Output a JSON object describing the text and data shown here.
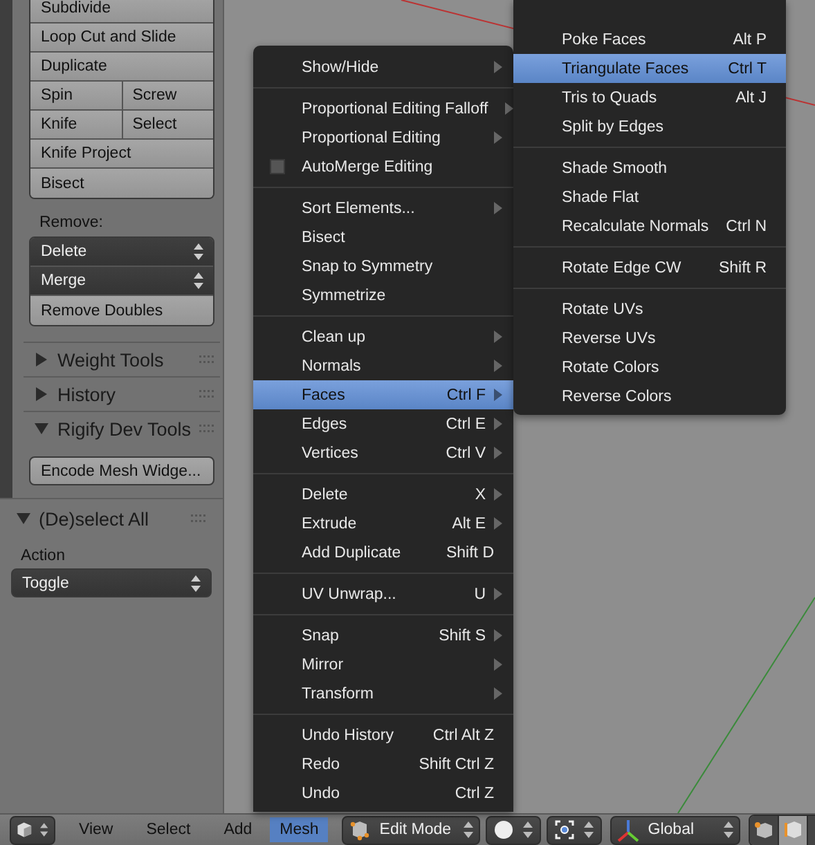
{
  "tool_shelf": {
    "button_rows": [
      [
        "Subdivide"
      ],
      [
        "Loop Cut and Slide"
      ],
      [
        "Duplicate"
      ],
      [
        "Spin",
        "Screw"
      ],
      [
        "Knife",
        "Select"
      ],
      [
        "Knife Project"
      ],
      [
        "Bisect"
      ]
    ],
    "remove_label": "Remove:",
    "remove_controls": [
      {
        "kind": "dropdown",
        "label": "Delete"
      },
      {
        "kind": "dropdown",
        "label": "Merge"
      },
      {
        "kind": "button",
        "label": "Remove Doubles"
      }
    ],
    "panels": [
      {
        "title": "Weight Tools",
        "expanded": false
      },
      {
        "title": "History",
        "expanded": false
      },
      {
        "title": "Rigify Dev Tools",
        "expanded": true
      }
    ],
    "rigify_button": "Encode Mesh Widge..."
  },
  "operator_panel": {
    "title": "(De)select All",
    "expanded": true,
    "field_label": "Action",
    "field_value": "Toggle"
  },
  "mesh_menu": {
    "sections": [
      [
        {
          "label": "Show/Hide",
          "submenu": true,
          "selected": false,
          "kind": "item"
        }
      ],
      [
        {
          "label": "Proportional Editing Falloff",
          "submenu": true,
          "selected": false,
          "kind": "item"
        },
        {
          "label": "Proportional Editing",
          "submenu": true,
          "selected": false,
          "kind": "item"
        },
        {
          "label": "AutoMerge Editing",
          "submenu": false,
          "selected": false,
          "kind": "checkbox",
          "checked": false
        }
      ],
      [
        {
          "label": "Sort Elements...",
          "submenu": true,
          "selected": false,
          "kind": "item"
        },
        {
          "label": "Bisect",
          "submenu": false,
          "selected": false,
          "kind": "item"
        },
        {
          "label": "Snap to Symmetry",
          "submenu": false,
          "selected": false,
          "kind": "item"
        },
        {
          "label": "Symmetrize",
          "submenu": false,
          "selected": false,
          "kind": "item"
        }
      ],
      [
        {
          "label": "Clean up",
          "submenu": true,
          "selected": false,
          "kind": "item"
        },
        {
          "label": "Normals",
          "submenu": true,
          "selected": false,
          "kind": "item"
        },
        {
          "label": "Faces",
          "shortcut": "Ctrl F",
          "submenu": true,
          "selected": true,
          "kind": "item"
        },
        {
          "label": "Edges",
          "shortcut": "Ctrl E",
          "submenu": true,
          "selected": false,
          "kind": "item"
        },
        {
          "label": "Vertices",
          "shortcut": "Ctrl V",
          "submenu": true,
          "selected": false,
          "kind": "item"
        }
      ],
      [
        {
          "label": "Delete",
          "shortcut": "X",
          "submenu": true,
          "selected": false,
          "kind": "item"
        },
        {
          "label": "Extrude",
          "shortcut": "Alt E",
          "submenu": true,
          "selected": false,
          "kind": "item"
        },
        {
          "label": "Add Duplicate",
          "shortcut": "Shift D",
          "submenu": false,
          "selected": false,
          "kind": "item"
        }
      ],
      [
        {
          "label": "UV Unwrap...",
          "shortcut": "U",
          "submenu": true,
          "selected": false,
          "kind": "item"
        }
      ],
      [
        {
          "label": "Snap",
          "shortcut": "Shift S",
          "submenu": true,
          "selected": false,
          "kind": "item"
        },
        {
          "label": "Mirror",
          "submenu": true,
          "selected": false,
          "kind": "item"
        },
        {
          "label": "Transform",
          "submenu": true,
          "selected": false,
          "kind": "item"
        }
      ],
      [
        {
          "label": "Undo History",
          "shortcut": "Ctrl Alt Z",
          "submenu": false,
          "selected": false,
          "kind": "item"
        },
        {
          "label": "Redo",
          "shortcut": "Shift Ctrl Z",
          "submenu": false,
          "selected": false,
          "kind": "item"
        },
        {
          "label": "Undo",
          "shortcut": "Ctrl Z",
          "submenu": false,
          "selected": false,
          "kind": "item"
        }
      ]
    ]
  },
  "faces_submenu": {
    "sections": [
      [
        {
          "label": "Poke Faces",
          "shortcut": "Alt P",
          "submenu": false,
          "selected": false,
          "kind": "item"
        },
        {
          "label": "Triangulate Faces",
          "shortcut": "Ctrl T",
          "submenu": false,
          "selected": true,
          "kind": "item"
        },
        {
          "label": "Tris to Quads",
          "shortcut": "Alt J",
          "submenu": false,
          "selected": false,
          "kind": "item"
        },
        {
          "label": "Split by Edges",
          "submenu": false,
          "selected": false,
          "kind": "item"
        }
      ],
      [
        {
          "label": "Shade Smooth",
          "submenu": false,
          "selected": false,
          "kind": "item"
        },
        {
          "label": "Shade Flat",
          "submenu": false,
          "selected": false,
          "kind": "item"
        },
        {
          "label": "Recalculate Normals",
          "shortcut": "Ctrl N",
          "submenu": false,
          "selected": false,
          "kind": "item"
        }
      ],
      [
        {
          "label": "Rotate Edge CW",
          "shortcut": "Shift R",
          "submenu": false,
          "selected": false,
          "kind": "item"
        }
      ],
      [
        {
          "label": "Rotate UVs",
          "submenu": false,
          "selected": false,
          "kind": "item"
        },
        {
          "label": "Reverse UVs",
          "submenu": false,
          "selected": false,
          "kind": "item"
        },
        {
          "label": "Rotate Colors",
          "submenu": false,
          "selected": false,
          "kind": "item"
        },
        {
          "label": "Reverse Colors",
          "submenu": false,
          "selected": false,
          "kind": "item"
        }
      ]
    ]
  },
  "header": {
    "menus": [
      {
        "label": "View",
        "selected": false
      },
      {
        "label": "Select",
        "selected": false
      },
      {
        "label": "Add",
        "selected": false
      },
      {
        "label": "Mesh",
        "selected": true
      }
    ],
    "mode_dropdown": "Edit Mode",
    "orientation_dropdown": "Global"
  }
}
